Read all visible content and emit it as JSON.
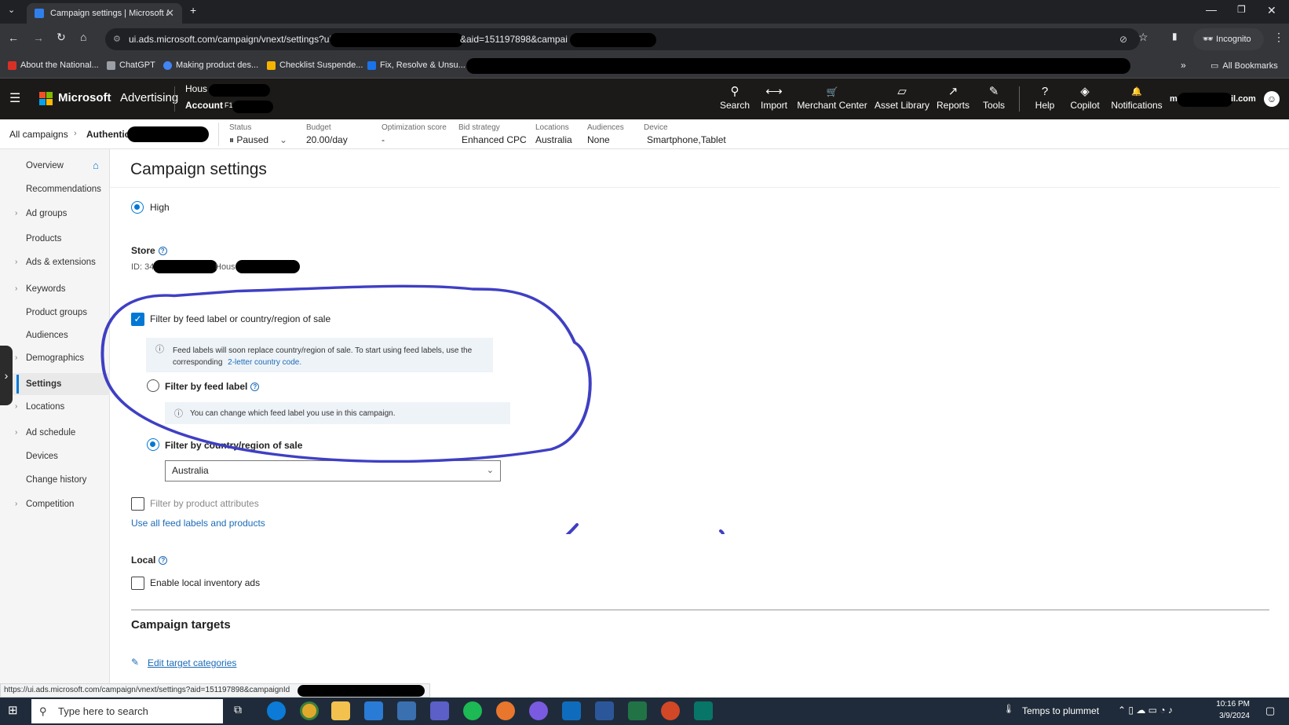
{
  "browser": {
    "tab_title": "Campaign settings | Microsoft /",
    "url_part1": "ui.ads.microsoft.com/campaign/vnext/settings?ui",
    "url_part2": "&aid=151197898&campai",
    "incognito_label": "Incognito",
    "all_bookmarks_label": "All Bookmarks",
    "bookmarks": [
      {
        "label": "About the National...",
        "color": "#d93025"
      },
      {
        "label": "ChatGPT",
        "color": "#9aa0a6"
      },
      {
        "label": "Making product des...",
        "color": "#4285f4"
      },
      {
        "label": "Checklist Suspende...",
        "color": "#f4b400"
      },
      {
        "label": "Fix, Resolve & Unsu...",
        "color": "#1a73e8"
      }
    ]
  },
  "app": {
    "brand_microsoft": "Microsoft",
    "brand_product": "Advertising",
    "account_line1": "Hous",
    "account_line2_prefix": "Account",
    "account_line2_suffix": "F1",
    "user_email_suffix": "il.com",
    "user_email_prefix": "m",
    "nav": [
      {
        "label": "Search",
        "icon": "search-icon",
        "glyph": "⚲"
      },
      {
        "label": "Import",
        "icon": "import-icon",
        "glyph": "⟷"
      },
      {
        "label": "Merchant Center",
        "icon": "cart-icon",
        "glyph": "🛒"
      },
      {
        "label": "Asset Library",
        "icon": "asset-library-icon",
        "glyph": "▱"
      },
      {
        "label": "Reports",
        "icon": "reports-icon",
        "glyph": "↗"
      },
      {
        "label": "Tools",
        "icon": "tools-icon",
        "glyph": "✎"
      },
      {
        "label": "Help",
        "icon": "help-icon",
        "glyph": "?"
      },
      {
        "label": "Copilot",
        "icon": "copilot-icon",
        "glyph": "◈"
      },
      {
        "label": "Notifications",
        "icon": "bell-icon",
        "glyph": "🔔"
      }
    ]
  },
  "campaign_bar": {
    "all_campaigns": "All campaigns",
    "campaign_name": "Authentic",
    "status": {
      "label": "Status",
      "value": "Paused"
    },
    "budget": {
      "label": "Budget",
      "value": "20.00/day"
    },
    "optimization": {
      "label": "Optimization score",
      "value": "-"
    },
    "bid_strategy": {
      "label": "Bid strategy",
      "value": "Enhanced CPC"
    },
    "locations": {
      "label": "Locations",
      "value": "Australia"
    },
    "audiences": {
      "label": "Audiences",
      "value": "None"
    },
    "device": {
      "label": "Device",
      "value": "Smartphone,Tablet"
    }
  },
  "sidebar": {
    "items": [
      {
        "label": "Overview",
        "chevron": false
      },
      {
        "label": "Recommendations",
        "chevron": false
      },
      {
        "label": "Ad groups",
        "chevron": true
      },
      {
        "label": "Products",
        "chevron": false
      },
      {
        "label": "Ads & extensions",
        "chevron": true
      },
      {
        "label": "Keywords",
        "chevron": true
      },
      {
        "label": "Product groups",
        "chevron": false
      },
      {
        "label": "Audiences",
        "chevron": false
      },
      {
        "label": "Demographics",
        "chevron": true
      },
      {
        "label": "Settings",
        "chevron": false,
        "active": true
      },
      {
        "label": "Locations",
        "chevron": true
      },
      {
        "label": "Ad schedule",
        "chevron": true
      },
      {
        "label": "Devices",
        "chevron": false
      },
      {
        "label": "Change history",
        "chevron": false
      },
      {
        "label": "Competition",
        "chevron": true
      }
    ]
  },
  "main": {
    "title": "Campaign settings",
    "priority_high_label": "High",
    "store_label": "Store",
    "store_id_prefix": "ID: 34",
    "store_name_prefix": "Hous",
    "filter_feed_checkbox_label": "Filter by feed label or country/region of sale",
    "feed_info_text": "Feed labels will soon replace country/region of sale. To start using feed labels, use the corresponding",
    "feed_info_link": "2-letter country code.",
    "filter_by_feed_label": "Filter by feed label",
    "feed_label_info": "You can change which feed label you use in this campaign.",
    "filter_by_country_label": "Filter by country/region of sale",
    "country_selected": "Australia",
    "filter_product_attrs_label": "Filter by product attributes",
    "use_all_link": "Use all feed labels and products",
    "local_label": "Local",
    "local_inventory_label": "Enable local inventory ads",
    "campaign_targets_title": "Campaign targets",
    "edit_target_link": "Edit target categories"
  },
  "status_url": "https://ui.ads.microsoft.com/campaign/vnext/settings?aid=151197898&campaignId",
  "taskbar": {
    "search_placeholder": "Type here to search",
    "weather_text": "Temps to plummet",
    "time": "10:16 PM",
    "date": "3/9/2024"
  },
  "colors": {
    "accent": "#0078d4",
    "annotation_ink": "#3f3fc4",
    "header_bg": "#1b1a19"
  }
}
